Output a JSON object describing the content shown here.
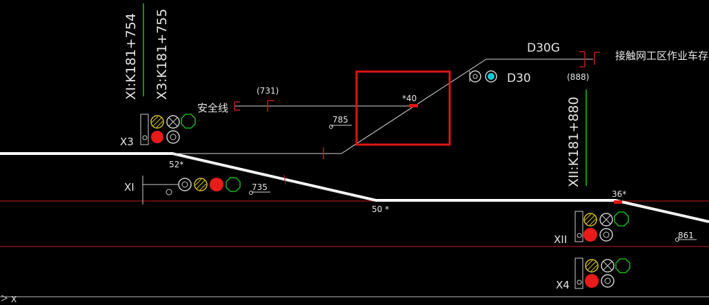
{
  "colors": {
    "background": "#000000",
    "track_main": "#ffffff",
    "track_thin": "#d9d9d9",
    "red_line": "#c81c1c",
    "green_line": "#19c419",
    "signal_red": "#e81b1b",
    "signal_yellow": "#d9c21c",
    "signal_green": "#1fb51f",
    "signal_white": "#d0d0d0",
    "cyan": "#16c8d6",
    "highlight_box": "#e01515"
  },
  "mileage_labels": {
    "xi": "XI:K181+754",
    "x3": "X3:K181+755",
    "xii": "XII:K181+880"
  },
  "texts": {
    "safety_line": "安全线",
    "storage_line": "接触网工区作业车存车线",
    "d30g": "D30G",
    "d30": "D30",
    "p731": "(731)",
    "p888": "(888)"
  },
  "signals": {
    "x3": "X3",
    "xi": "XI",
    "xii": "XII",
    "x4": "X4"
  },
  "switch_labels": {
    "s40": "*40",
    "s52": "52*",
    "s50": "50 *",
    "s36": "36*"
  },
  "marker_labels": {
    "m785": "785",
    "m735": "735",
    "m861": "861"
  },
  "ucs": {
    "x": "X"
  }
}
